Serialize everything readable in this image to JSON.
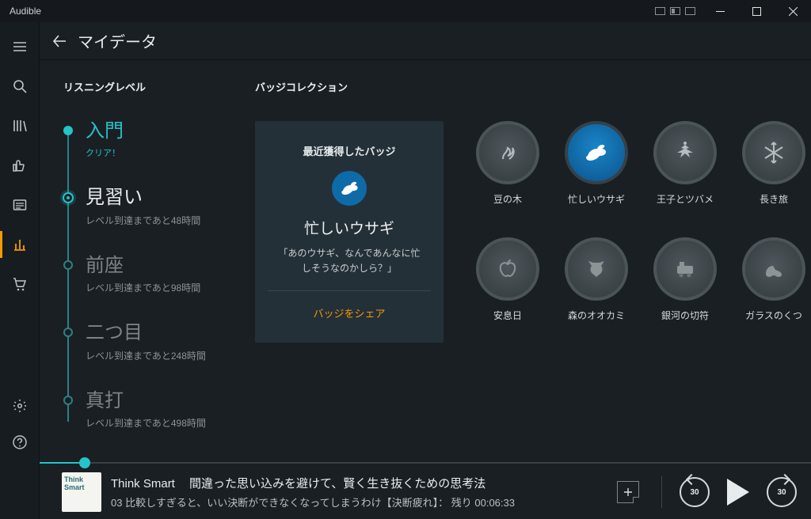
{
  "titlebar": {
    "app": "Audible"
  },
  "header": {
    "title": "マイデータ"
  },
  "sections": {
    "listening": "リスニングレベル",
    "badges": "バッジコレクション"
  },
  "levels": [
    {
      "name": "入門",
      "sub": "クリア！",
      "state": "done"
    },
    {
      "name": "見習い",
      "sub": "レベル到達まであと48時間",
      "state": "current"
    },
    {
      "name": "前座",
      "sub": "レベル到達まであと98時間",
      "state": "future"
    },
    {
      "name": "二つ目",
      "sub": "レベル到達まであと248時間",
      "state": "future"
    },
    {
      "name": "真打",
      "sub": "レベル到達まであと498時間",
      "state": "future"
    }
  ],
  "card": {
    "title": "最近獲得したバッジ",
    "name": "忙しいウサギ",
    "desc": "「あのウサギ、なんであんなに忙しそうなのかしら？」",
    "share": "バッジをシェア"
  },
  "badgesRow1": [
    {
      "label": "豆の木",
      "icon": "vine"
    },
    {
      "label": "忙しいウサギ",
      "icon": "rabbit",
      "earned": true
    },
    {
      "label": "王子とツバメ",
      "icon": "swallow"
    },
    {
      "label": "長き旅",
      "icon": "snowflake"
    }
  ],
  "badgesRow2": [
    {
      "label": "安息日",
      "icon": "apple"
    },
    {
      "label": "森のオオカミ",
      "icon": "wolf"
    },
    {
      "label": "銀河の切符",
      "icon": "train"
    },
    {
      "label": "ガラスのくつ",
      "icon": "shoe"
    }
  ],
  "player": {
    "title": "Think Smart",
    "subtitle": "間違った思い込みを避けて、賢く生き抜くための思考法",
    "chapter": "03 比較しすぎると、いい決断ができなくなってしまうわけ【決断疲れ】： 残り 00:06:33",
    "skip": "30"
  }
}
